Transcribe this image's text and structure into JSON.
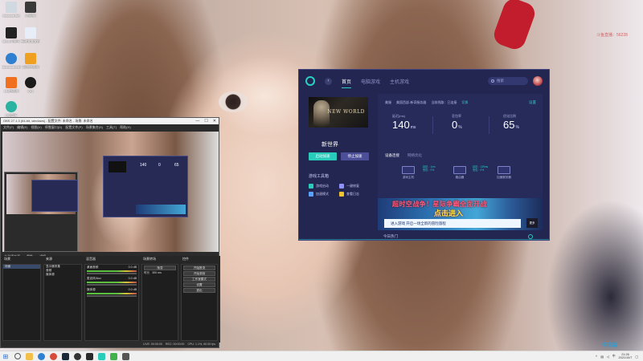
{
  "wallpaper": {
    "watermark": "斗鱼直播：56228"
  },
  "desktop_icons": [
    {
      "label": "Recycle Bin",
      "color": "#d0d8e0"
    },
    {
      "label": "此电脑",
      "color": "#3a3a3a"
    },
    {
      "label": "MCS 全能王",
      "color": "#222222"
    },
    {
      "label": "新建文本文档",
      "color": "#e8eef8"
    },
    {
      "label": "Microsoft Edge",
      "color": "#2f80d0"
    },
    {
      "label": "奇游加速器",
      "color": "#f0a020"
    },
    {
      "label": "UU加速器",
      "color": "#f07020"
    },
    {
      "label": "QQ",
      "color": "#1b1b1b"
    },
    {
      "label": "QQ音乐",
      "color": "#29b3a0"
    }
  ],
  "obs": {
    "title": "OBS 27.1.3 (64-bit, windows) - 配置文件: 未命名 - 场景: 未命名",
    "window_controls": [
      "—",
      "☐",
      "✕"
    ],
    "menu": [
      "文件(F)",
      "编辑(E)",
      "视图(V)",
      "停靠窗口(D)",
      "配置文件(P)",
      "场景集合(S)",
      "工具(T)",
      "帮助(H)"
    ],
    "scene_label": "未选择来源",
    "props_label": "属性",
    "filters_label": "滤镜",
    "docks": {
      "scenes": {
        "title": "场景",
        "items": [
          "场景"
        ]
      },
      "sources": {
        "title": "来源",
        "items": [
          "显示器采集",
          "音频",
          "媒体源"
        ]
      },
      "mixer": {
        "title": "混音器",
        "channels": [
          {
            "name": "桌面音频",
            "db": "0.0 dB"
          },
          {
            "name": "麦克风/Aux",
            "db": "0.0 dB"
          },
          {
            "name": "媒体源",
            "db": "0.0 dB"
          }
        ]
      },
      "transitions": {
        "title": "场景转场",
        "type": "渐变",
        "duration_label": "时长",
        "duration": "300 ms"
      },
      "controls": {
        "title": "控件",
        "buttons": [
          "开始推流",
          "开始录制",
          "工作室模式",
          "设置",
          "退出"
        ]
      }
    },
    "status": [
      "LIVE: 00:00:00",
      "REC: 00:00:00",
      "CPU: 1.1%, 60.00 fps"
    ]
  },
  "app": {
    "nav": {
      "back_icon": "‹",
      "tabs": [
        "首页",
        "电脑游戏",
        "主机游戏"
      ],
      "active_tab": 0
    },
    "search": {
      "placeholder": "搜索"
    },
    "game": {
      "name": "新世界",
      "cover_title": "NEW WORLD",
      "accelerate_button": "启动加速",
      "stop_button": "停止加速"
    },
    "tools": {
      "title": "游戏工具箱",
      "items": [
        "游戏启动",
        "一键修复",
        "加速模式",
        "查看日志"
      ]
    },
    "info": {
      "region": "美服",
      "server": "美国西部-新奇服务器",
      "ping_note": "当前线路：已连接",
      "link": "切换",
      "manage": "设置"
    },
    "stats": [
      {
        "label": "延迟(ms)",
        "value": "140",
        "unit": "ms"
      },
      {
        "label": "丢包率",
        "value": "0",
        "unit": "%"
      },
      {
        "label": "优化比例",
        "value": "65",
        "unit": "%"
      }
    ],
    "net_tabs": [
      "设备连接",
      "网络优化"
    ],
    "active_net_tab": 0,
    "topology": [
      {
        "label": "游戏主机"
      },
      {
        "label": "路由器"
      },
      {
        "label": "加速服务器"
      }
    ],
    "links": [
      {
        "line1": "延迟：1ms",
        "line2": "丢包：0%"
      },
      {
        "line1": "延迟：139ms",
        "line2": "丢包：0%"
      }
    ],
    "banner": {
      "line1": "超时空战争！星际争霸全面开战",
      "line2": "点击进入",
      "line3": "进入游戏  开启一场全新的冒险旅程",
      "badge": "更多"
    },
    "footer_label": "今日热门",
    "accent": "#29cbbb"
  },
  "taskbar": {
    "apps": [
      {
        "name": "file-explorer",
        "color": "#f2c04a"
      },
      {
        "name": "edge",
        "color": "#2f80d0"
      },
      {
        "name": "chrome",
        "color": "#d64a3a"
      },
      {
        "name": "steam",
        "color": "#1b2838"
      },
      {
        "name": "obs",
        "color": "#333333"
      },
      {
        "name": "qq",
        "color": "#2a2a2a"
      },
      {
        "name": "accelerator",
        "color": "#29cbbb"
      },
      {
        "name": "wechat",
        "color": "#3fb34a"
      },
      {
        "name": "settings",
        "color": "#555555"
      }
    ],
    "tray_lang": "中",
    "time": "21:26",
    "date": "2021/10/7",
    "watermark": "中文版"
  }
}
